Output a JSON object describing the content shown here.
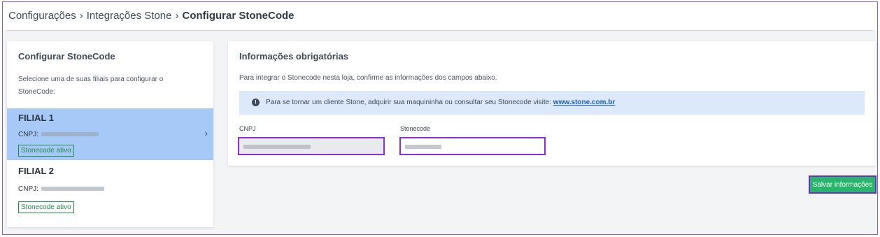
{
  "breadcrumb": {
    "items": [
      "Configurações",
      "Integrações Stone"
    ],
    "current": "Configurar StoneCode",
    "separator": "›"
  },
  "left_panel": {
    "title": "Configurar StoneCode",
    "description": "Selecione uma de suas filiais para configurar o StoneCode:",
    "branches": [
      {
        "name": "FILIAL 1",
        "cnpj_label": "CNPJ:",
        "cnpj_value": "",
        "badge": "Stonecode ativo",
        "selected": true
      },
      {
        "name": "FILIAL 2",
        "cnpj_label": "CNPJ:",
        "cnpj_value": "",
        "badge": "Stonecode ativo",
        "selected": false
      }
    ],
    "chevron_icon": "chevron-right-icon"
  },
  "right_panel": {
    "title": "Informações obrigatórias",
    "description": "Para integrar o Stonecode nesta loja, confirme as informações dos campos abaixo.",
    "info": {
      "icon": "info-circle-icon",
      "text": "Para se tornar um cliente Stone, adquirir sua maquininha ou consultar seu Stonecode visite:",
      "link": "www.stone.com.br"
    },
    "fields": {
      "cnpj_label": "CNPJ",
      "stonecode_label": "Stonecode"
    }
  },
  "actions": {
    "save_label": "Salvar informações"
  },
  "colors": {
    "selected_branch_bg": "#a7c9f8",
    "badge_green": "#1f8a4c",
    "save_button_bg": "#27b569",
    "highlight_border": "#8a2ee0",
    "info_box_bg": "#dbe9fb",
    "link_blue": "#1b5fc1"
  }
}
